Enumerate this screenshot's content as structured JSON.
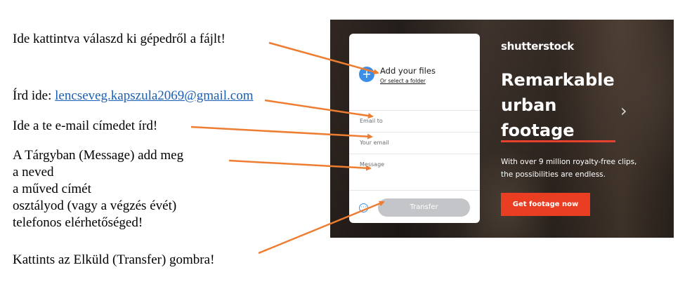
{
  "instructions": {
    "choose_file": "Ide kattintva válaszd ki gépedről a fájlt!",
    "email_to_prefix": "Írd ide: ",
    "email_to_address": "lencseveg.kapszula2069@gmail.com",
    "your_email": "Ide a te e-mail címedet írd!",
    "message_lines": [
      "A Tárgyban (Message) add meg",
      "a neved",
      "a műved címét",
      "osztályod (vagy a végzés évét)",
      "telefonos elérhetőséged!"
    ],
    "click_transfer": "Kattints az Elküld (Transfer) gombra!"
  },
  "transfer_card": {
    "add_files_title": "Add your files",
    "select_folder": "Or select a folder",
    "plus_icon": "plus-icon",
    "email_to_placeholder": "Email to",
    "your_email_placeholder": "Your email",
    "message_placeholder": "Message",
    "more_icon": "more-options-icon",
    "transfer_button": "Transfer"
  },
  "ad": {
    "brand": "shutterstock",
    "headline": [
      "Remarkable",
      "urban",
      "footage"
    ],
    "subtitle": [
      "With over 9 million royalty-free clips,",
      "the possibilities are endless."
    ],
    "cta": "Get footage now",
    "next_icon": "chevron-right-icon"
  },
  "colors": {
    "arrow": "#ed7d31",
    "link": "#1a5fb4",
    "accent_blue": "#3a8ee6",
    "cta_red": "#ea3e23",
    "button_gray": "#c3c5c8"
  }
}
